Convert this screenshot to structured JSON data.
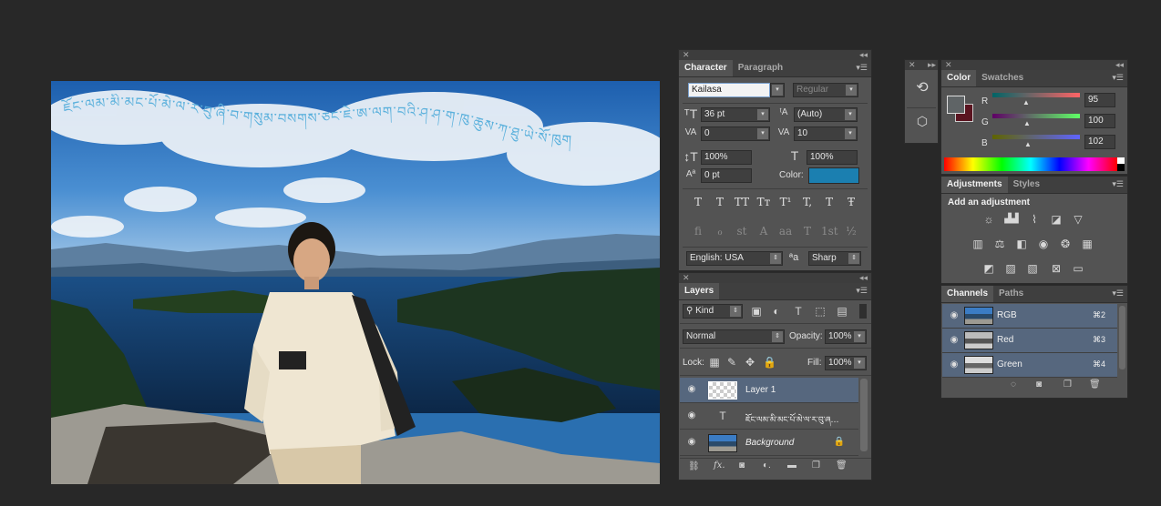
{
  "character_panel": {
    "tabs": [
      "Character",
      "Paragraph"
    ],
    "font_family": "Kailasa",
    "font_style": "Regular",
    "font_size": "36 pt",
    "leading": "(Auto)",
    "kerning": "0",
    "tracking": "10",
    "vertical_scale": "100%",
    "horizontal_scale": "100%",
    "baseline_shift": "0 pt",
    "color_label": "Color:",
    "color_swatch": "#1b7fb0",
    "type_buttons": [
      "T",
      "T",
      "TT",
      "Tт",
      "T¹",
      "T,",
      "T",
      "Ŧ"
    ],
    "opentype_buttons": [
      "fi",
      "ℴ",
      "st",
      "A",
      "aa",
      "T",
      "1st",
      "½"
    ],
    "language": "English: USA",
    "aa_label": "ªa",
    "antialias": "Sharp"
  },
  "layers_panel": {
    "tab": "Layers",
    "filter_kind": "Kind",
    "blend_mode": "Normal",
    "opacity_label": "Opacity:",
    "opacity": "100%",
    "lock_label": "Lock:",
    "fill_label": "Fill:",
    "fill": "100%",
    "layers": [
      {
        "name": "Layer 1",
        "type": "pixel",
        "selected": true
      },
      {
        "name": "ཇོང་ལམ་མི་མང་པོ་མེ་ལ་ར་བུ་ཞ…",
        "type": "text",
        "selected": false
      },
      {
        "name": "Background",
        "type": "image",
        "selected": false,
        "locked": true
      }
    ]
  },
  "color_panel": {
    "tabs": [
      "Color",
      "Swatches"
    ],
    "channels": [
      {
        "label": "R",
        "value": "95"
      },
      {
        "label": "G",
        "value": "100"
      },
      {
        "label": "B",
        "value": "102"
      }
    ],
    "foreground": "#5a1420",
    "background": "#ffffff"
  },
  "adjustments_panel": {
    "tabs": [
      "Adjustments",
      "Styles"
    ],
    "heading": "Add an adjustment"
  },
  "channels_panel": {
    "tabs": [
      "Channels",
      "Paths"
    ],
    "channels": [
      {
        "name": "RGB",
        "shortcut": "⌘2"
      },
      {
        "name": "Red",
        "shortcut": "⌘3"
      },
      {
        "name": "Green",
        "shortcut": "⌘4"
      }
    ]
  }
}
